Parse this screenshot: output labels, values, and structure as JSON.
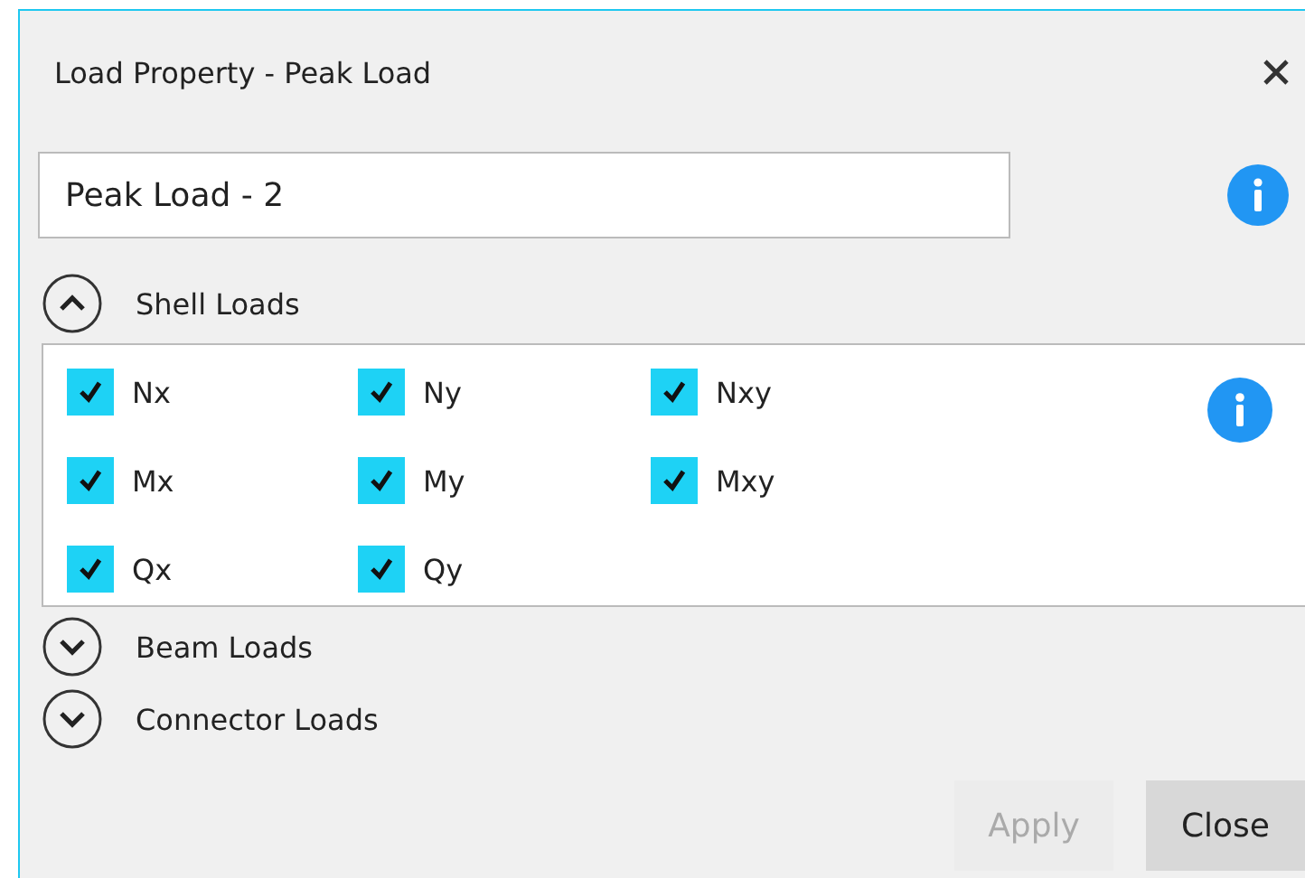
{
  "window": {
    "title": "Load Property - Peak Load"
  },
  "name_field": {
    "value": "Peak Load - 2"
  },
  "sections": [
    {
      "label": "Shell Loads",
      "expanded": true,
      "options": [
        {
          "label": "Nx",
          "checked": true
        },
        {
          "label": "Ny",
          "checked": true
        },
        {
          "label": "Nxy",
          "checked": true
        },
        {
          "label": "Mx",
          "checked": true
        },
        {
          "label": "My",
          "checked": true
        },
        {
          "label": "Mxy",
          "checked": true
        },
        {
          "label": "Qx",
          "checked": true
        },
        {
          "label": "Qy",
          "checked": true
        }
      ]
    },
    {
      "label": "Beam Loads",
      "expanded": false
    },
    {
      "label": "Connector Loads",
      "expanded": false
    }
  ],
  "buttons": [
    {
      "label": "Apply",
      "disabled": true
    },
    {
      "label": "Close",
      "disabled": false
    }
  ]
}
